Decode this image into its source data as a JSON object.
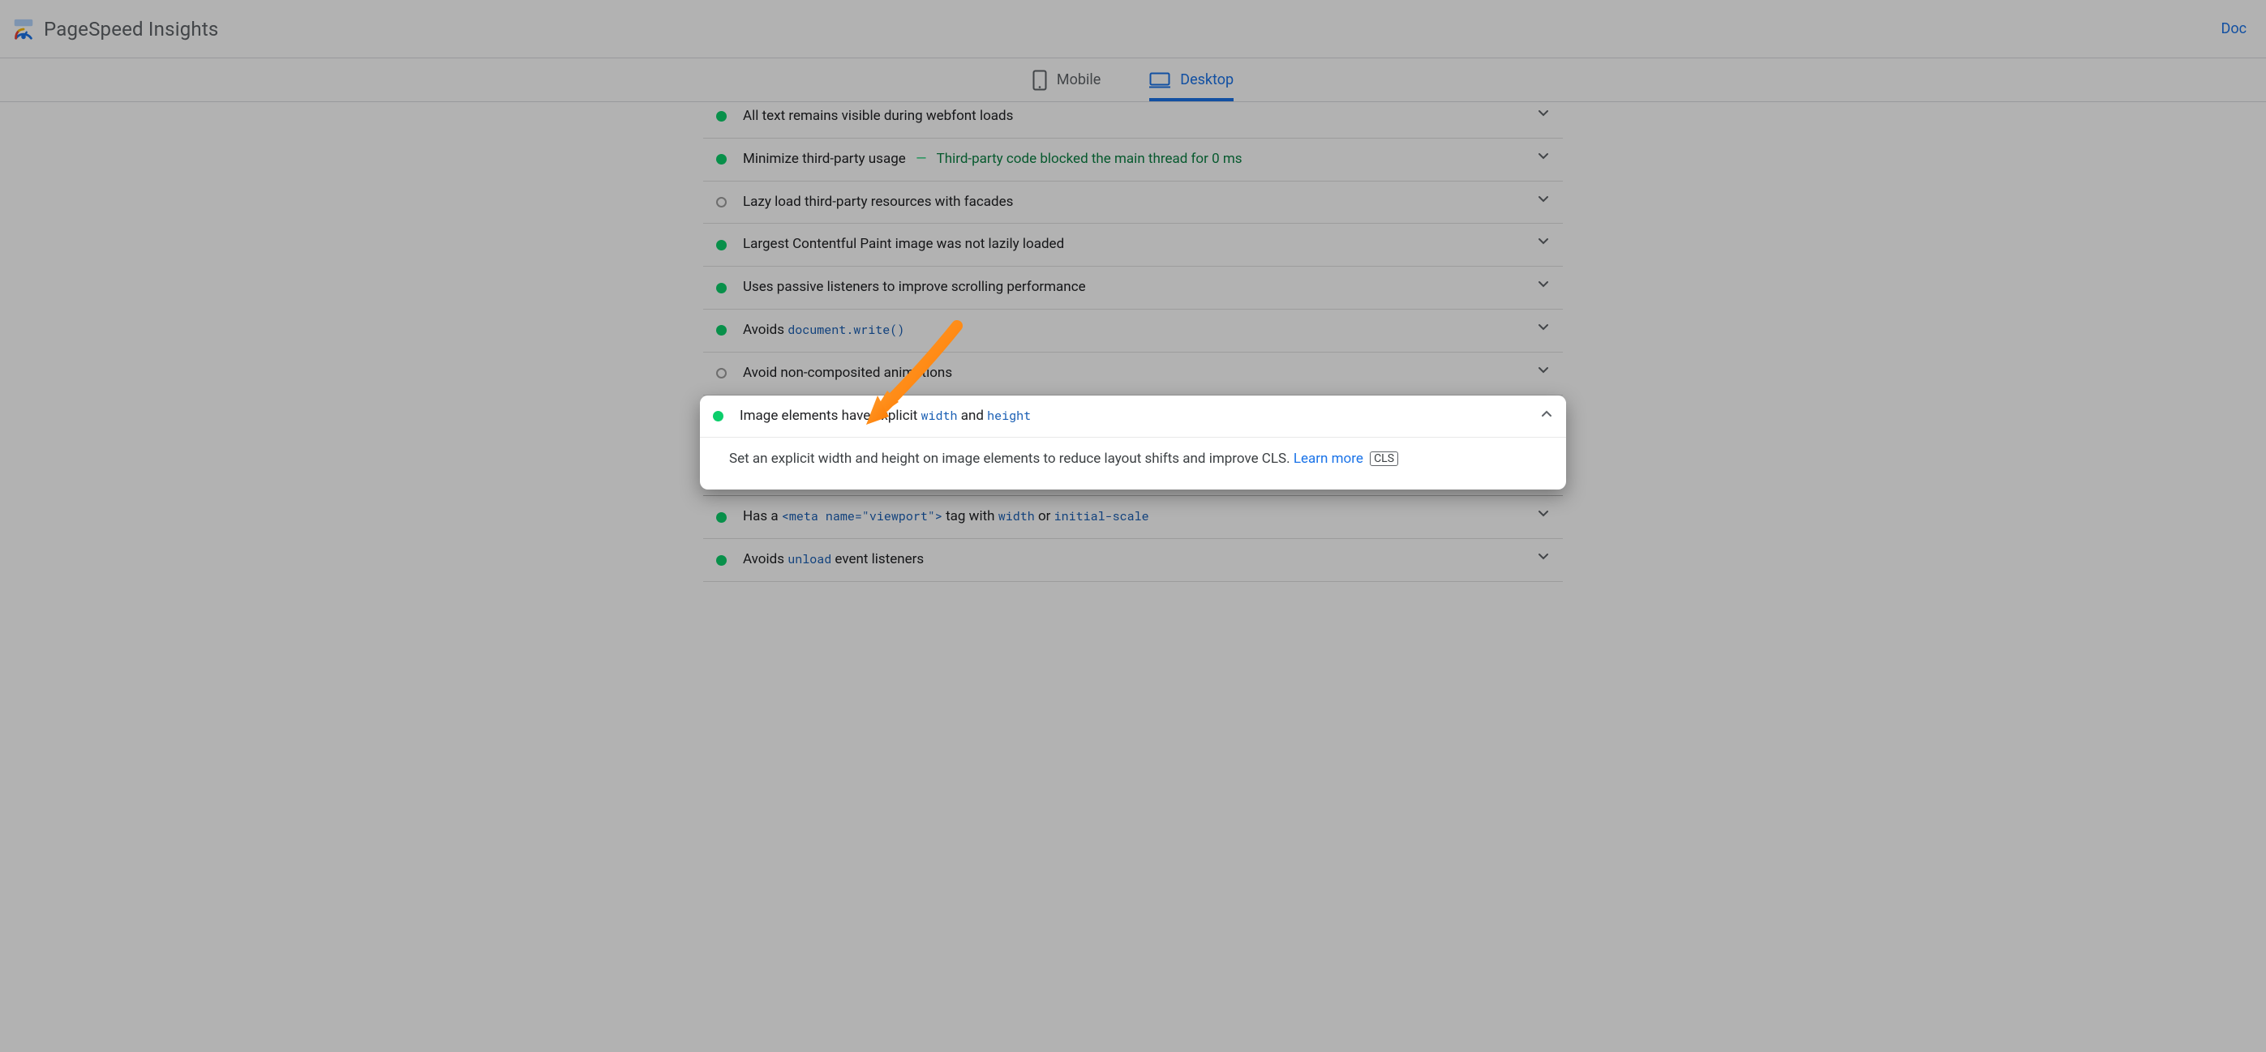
{
  "header": {
    "title": "PageSpeed Insights",
    "docs_label": "Doc"
  },
  "tabs": {
    "mobile": "Mobile",
    "desktop": "Desktop",
    "active": "desktop"
  },
  "audits": [
    {
      "status": "pass",
      "title_plain": "All text remains visible during webfont loads"
    },
    {
      "status": "pass",
      "title_plain": "Minimize third-party usage",
      "detail_green": "Third-party code blocked the main thread for 0 ms"
    },
    {
      "status": "info",
      "title_plain": "Lazy load third-party resources with facades"
    },
    {
      "status": "pass",
      "title_plain": "Largest Contentful Paint image was not lazily loaded"
    },
    {
      "status": "pass",
      "title_plain": "Uses passive listeners to improve scrolling performance"
    },
    {
      "status": "pass",
      "title_prefix": "Avoids ",
      "code1": "document.write()"
    },
    {
      "status": "info",
      "title_plain": "Avoid non-composited animations"
    },
    {
      "status": "pass",
      "expanded": true,
      "title_prefix": "Image elements have explicit ",
      "code1": "width",
      "mid": " and ",
      "code2": "height",
      "description": "Set an explicit width and height on image elements to reduce layout shifts and improve CLS. ",
      "learn_more": "Learn more",
      "tag": "CLS"
    },
    {
      "status": "pass",
      "title_prefix": "Has a ",
      "code1": "<meta name=\"viewport\">",
      "mid": " tag with ",
      "code2": "width",
      "mid2": " or ",
      "code3": "initial-scale"
    },
    {
      "status": "pass",
      "title_prefix": "Avoids ",
      "code1": "unload",
      "mid": " event listeners"
    }
  ]
}
